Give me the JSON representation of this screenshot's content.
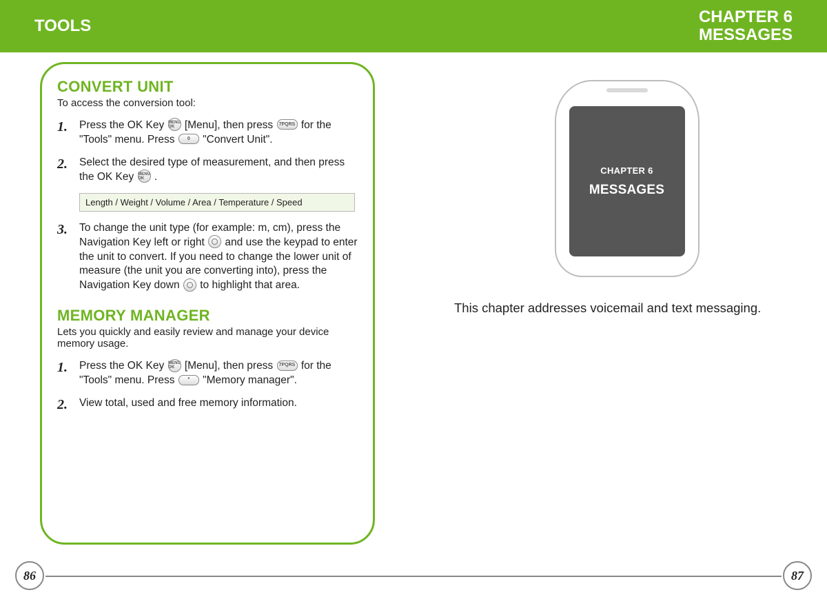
{
  "header": {
    "left": "TOOLS",
    "right_line1": "CHAPTER 6",
    "right_line2": "MESSAGES"
  },
  "left_page": {
    "section1": {
      "heading": "CONVERT UNIT",
      "intro": "To access the conversion tool:",
      "steps": [
        {
          "num": "1.",
          "before_ok": "Press the OK Key ",
          "after_ok": " [Menu], then press ",
          "after_pill7": " for the \"Tools\" menu. Press ",
          "after_pill0": " \"Convert Unit\"."
        },
        {
          "num": "2.",
          "before_ok": "Select the desired type of measurement, and then press the OK Key ",
          "after_ok": " ."
        }
      ],
      "options_box": "Length / Weight / Volume / Area / Temperature / Speed",
      "step3": {
        "num": "3.",
        "t1": "To change the unit type (for example: m, cm), press the Navigation Key left or right ",
        "t2": " and use the keypad to enter the unit to convert.  If you need to change the lower unit of measure (the unit you are converting into), press the Navigation Key down ",
        "t3": " to highlight that area."
      }
    },
    "section2": {
      "heading": "MEMORY MANAGER",
      "intro": "Lets you quickly and easily review and manage your device memory usage.",
      "steps": [
        {
          "num": "1.",
          "before_ok": "Press the OK Key ",
          "after_ok": " [Menu], then press ",
          "after_pill7": " for the \"Tools\" menu. Press ",
          "after_pillstar": " \"Memory manager\"."
        },
        {
          "num": "2.",
          "text": "View total, used and free memory information."
        }
      ]
    },
    "pagenum": "86"
  },
  "right_page": {
    "phone": {
      "chapter_label": "CHAPTER 6",
      "chapter_title": "MESSAGES"
    },
    "description": "This chapter addresses voicemail and text messaging.",
    "pagenum": "87"
  },
  "keys": {
    "ok": "MENU OK",
    "pill7": "7PQRS",
    "pill0": "0",
    "pillstar": "*"
  }
}
